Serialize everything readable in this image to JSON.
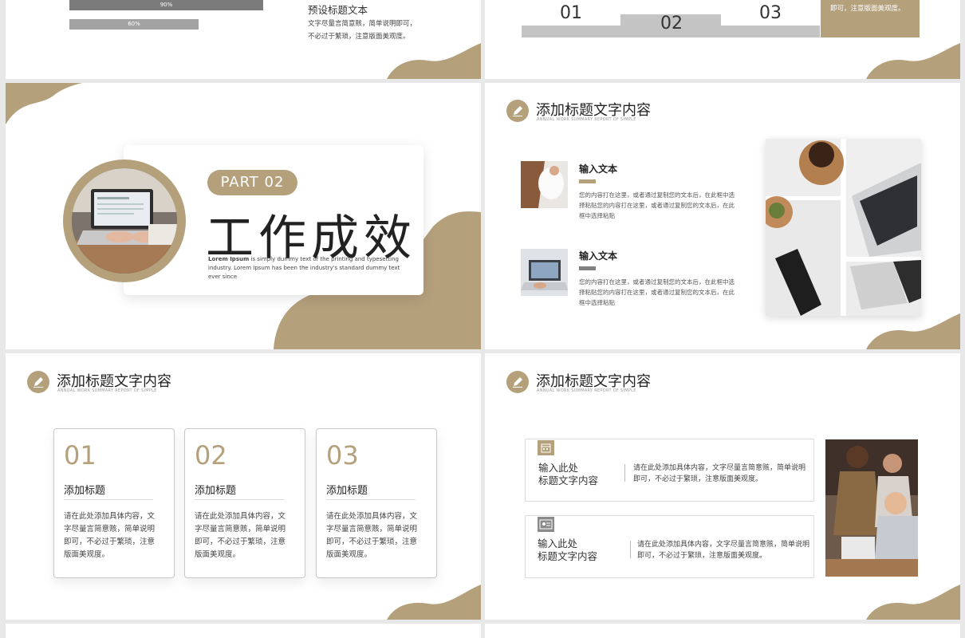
{
  "colors": {
    "accent": "#b5a07c",
    "bar_dark": "#7b7b7b",
    "bar_light": "#a3a3a3",
    "background": "#e8e8e8"
  },
  "slide_topleft": {
    "bars": [
      {
        "label": "90%",
        "value": 0.9
      },
      {
        "label": "60%",
        "value": 0.6
      }
    ],
    "title": "预设标题文本",
    "desc_line1": "文字尽量言简意赅，简单说明即可，",
    "desc_line2": "不必过于繁琐，注意版面美观度。"
  },
  "slide_topright": {
    "numbers": [
      "01",
      "02",
      "03"
    ],
    "side_text": "即可，注意版面美观度。"
  },
  "section": {
    "part_label": "PART 02",
    "title": "工作成效",
    "lorem_bold": "Lorem Ipsum",
    "lorem_rest": " is simply dummy text of the printing and typesetting industry. Lorem Ipsum has been the industry's standard dummy text ever since",
    "image_icon": "laptop-photo"
  },
  "header": {
    "title": "添加标题文字内容",
    "subtitle": "ANNUAL WORK SUMMARY REPORT OF SIMPLE",
    "icon": "pencil-icon"
  },
  "input_slide": {
    "items": [
      {
        "title": "输入文本",
        "desc": "您的内容打在这里，或者通过复制您的文本后，在此框中选择粘贴您的内容打在这里，或者通过复制您的文本后，在此框中选择粘贴"
      },
      {
        "title": "输入文本",
        "desc": "您的内容打在这里，或者通过复制您的文本后，在此框中选择粘贴您的内容打在这里，或者通过复制您的文本后，在此框中选择粘贴"
      }
    ]
  },
  "cards_slide": {
    "cards": [
      {
        "num": "01",
        "title": "添加标题",
        "desc": "请在此处添加具体内容，文字尽量言简意赅，简单说明即可，不必过于繁琐，注意版面美观度。"
      },
      {
        "num": "02",
        "title": "添加标题",
        "desc": "请在此处添加具体内容，文字尽量言简意赅，简单说明即可，不必过于繁琐，注意版面美观度。"
      },
      {
        "num": "03",
        "title": "添加标题",
        "desc": "请在此处添加具体内容，文字尽量言简意赅，简单说明即可，不必过于繁琐，注意版面美观度。"
      }
    ]
  },
  "list_slide": {
    "rows": [
      {
        "icon": "calendar-icon",
        "title": "输入此处\n标题文字内容",
        "desc": "请在此处添加具体内容，文字尽量言简意赅，简单说明即可，不必过于繁琐，注意版面美观度。"
      },
      {
        "icon": "id-card-icon",
        "title": "输入此处\n标题文字内容",
        "desc": "请在此处添加具体内容，文字尽量言简意赅，简单说明即可，不必过于繁琐，注意版面美观度。"
      }
    ]
  }
}
